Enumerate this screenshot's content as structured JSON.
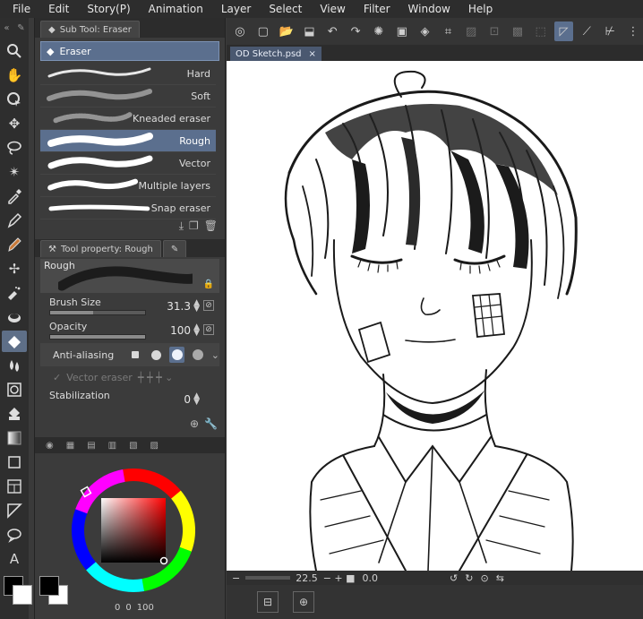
{
  "menu": [
    "File",
    "Edit",
    "Story(P)",
    "Animation",
    "Layer",
    "Select",
    "View",
    "Filter",
    "Window",
    "Help"
  ],
  "subtool_panel": {
    "tab_label": "Sub Tool: Eraser",
    "group_label": "Eraser",
    "brushes": [
      {
        "label": "Hard"
      },
      {
        "label": "Soft"
      },
      {
        "label": "Kneaded eraser"
      },
      {
        "label": "Rough",
        "selected": true
      },
      {
        "label": "Vector"
      },
      {
        "label": "Multiple layers"
      },
      {
        "label": "Snap eraser"
      }
    ]
  },
  "tool_property": {
    "tab_label": "Tool property: Rough",
    "preview_label": "Rough",
    "brush_size_label": "Brush Size",
    "brush_size_value": "31.3",
    "brush_size_fill": 0.45,
    "opacity_label": "Opacity",
    "opacity_value": "100",
    "opacity_fill": 1.0,
    "antialiasing_label": "Anti-aliasing",
    "vector_eraser_label": "Vector eraser",
    "stabilization_label": "Stabilization",
    "stabilization_value": "0"
  },
  "color": {
    "foreground": "#000000",
    "background": "#ffffff",
    "readout": [
      "0",
      "0",
      "100"
    ]
  },
  "document": {
    "tab_title": "OD Sketch.psd",
    "close_glyph": "×"
  },
  "navigator": {
    "zoom": "22.5",
    "rotation": "0.0"
  },
  "accent": "#5b6f8e"
}
